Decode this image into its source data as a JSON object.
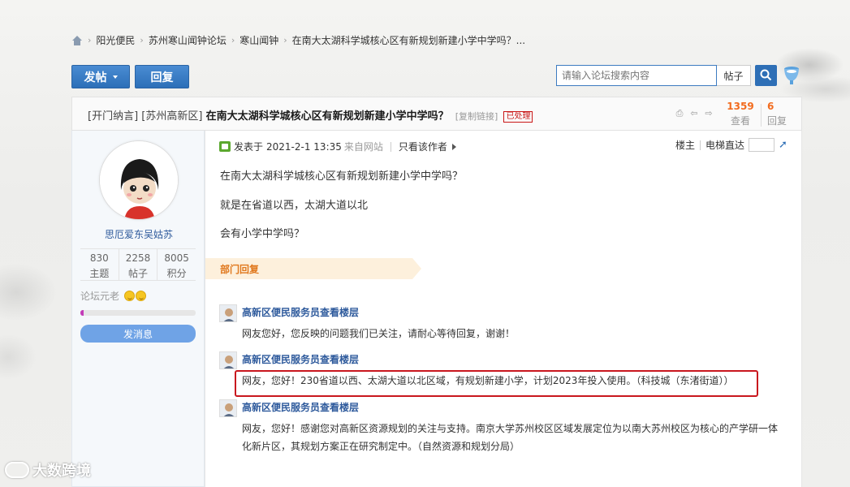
{
  "breadcrumb": {
    "items": [
      "阳光便民",
      "苏州寒山闻钟论坛",
      "寒山闻钟",
      "在南大太湖科学城核心区有新规划新建小学中学吗？..."
    ],
    "separator": "›"
  },
  "toolbar": {
    "post_label": "发帖",
    "reply_label": "回复"
  },
  "search": {
    "placeholder": "请输入论坛搜索内容",
    "type_label": "帖子"
  },
  "thread": {
    "prefix": "[开门纳言] [苏州高新区]",
    "title": "在南大太湖科学城核心区有新规划新建小学中学吗？",
    "copy_link": "[复制链接]",
    "status_badge": "已处理",
    "views_count": "1359",
    "views_label": "查看",
    "replies_count": "6",
    "replies_label": "回复"
  },
  "author": {
    "name": "思厄爱东吴姑苏",
    "stats": [
      {
        "num": "830",
        "label": "主题"
      },
      {
        "num": "2258",
        "label": "帖子"
      },
      {
        "num": "8005",
        "label": "积分"
      }
    ],
    "rank": "论坛元老",
    "progress_fraction": 0.03,
    "message_button": "发消息"
  },
  "post": {
    "posted_prefix": "发表于",
    "posted_at": "2021-2-1 13:35",
    "source": "来自网站",
    "only_author": "只看该作者",
    "floor_label": "楼主",
    "goto_label": "电梯直达",
    "paragraphs": [
      "在南大太湖科学城核心区有新规划新建小学中学吗？",
      "就是在省道以西，太湖大道以北",
      "会有小学中学吗？"
    ]
  },
  "department": {
    "banner": "部门回复",
    "replies": [
      {
        "name": "高新区便民服务员查看楼层",
        "lines": [
          "网友您好，您反映的问题我们已关注，请耐心等待回复，谢谢！"
        ]
      },
      {
        "name": "高新区便民服务员查看楼层",
        "lines": [
          "网友，您好！230省道以西、太湖大道以北区域，有规划新建小学，计划2023年投入使用。（科技城（东渚街道））"
        ]
      },
      {
        "name": "高新区便民服务员查看楼层",
        "lines": [
          "网友，您好！感谢您对高新区资源规划的关注与支持。南京大学苏州校区区域发展定位为以南大苏州校区为核心的产学研一体",
          "化新片区，其规划方案正在研究制定中。（自然资源和规划分局）"
        ]
      }
    ]
  },
  "watermark": {
    "text": "大数跨境"
  },
  "colors": {
    "primary_blue": "#2e6fb6",
    "link_blue": "#2e5a9c",
    "orange": "#e0781d",
    "highlight_red": "#c9171e"
  }
}
